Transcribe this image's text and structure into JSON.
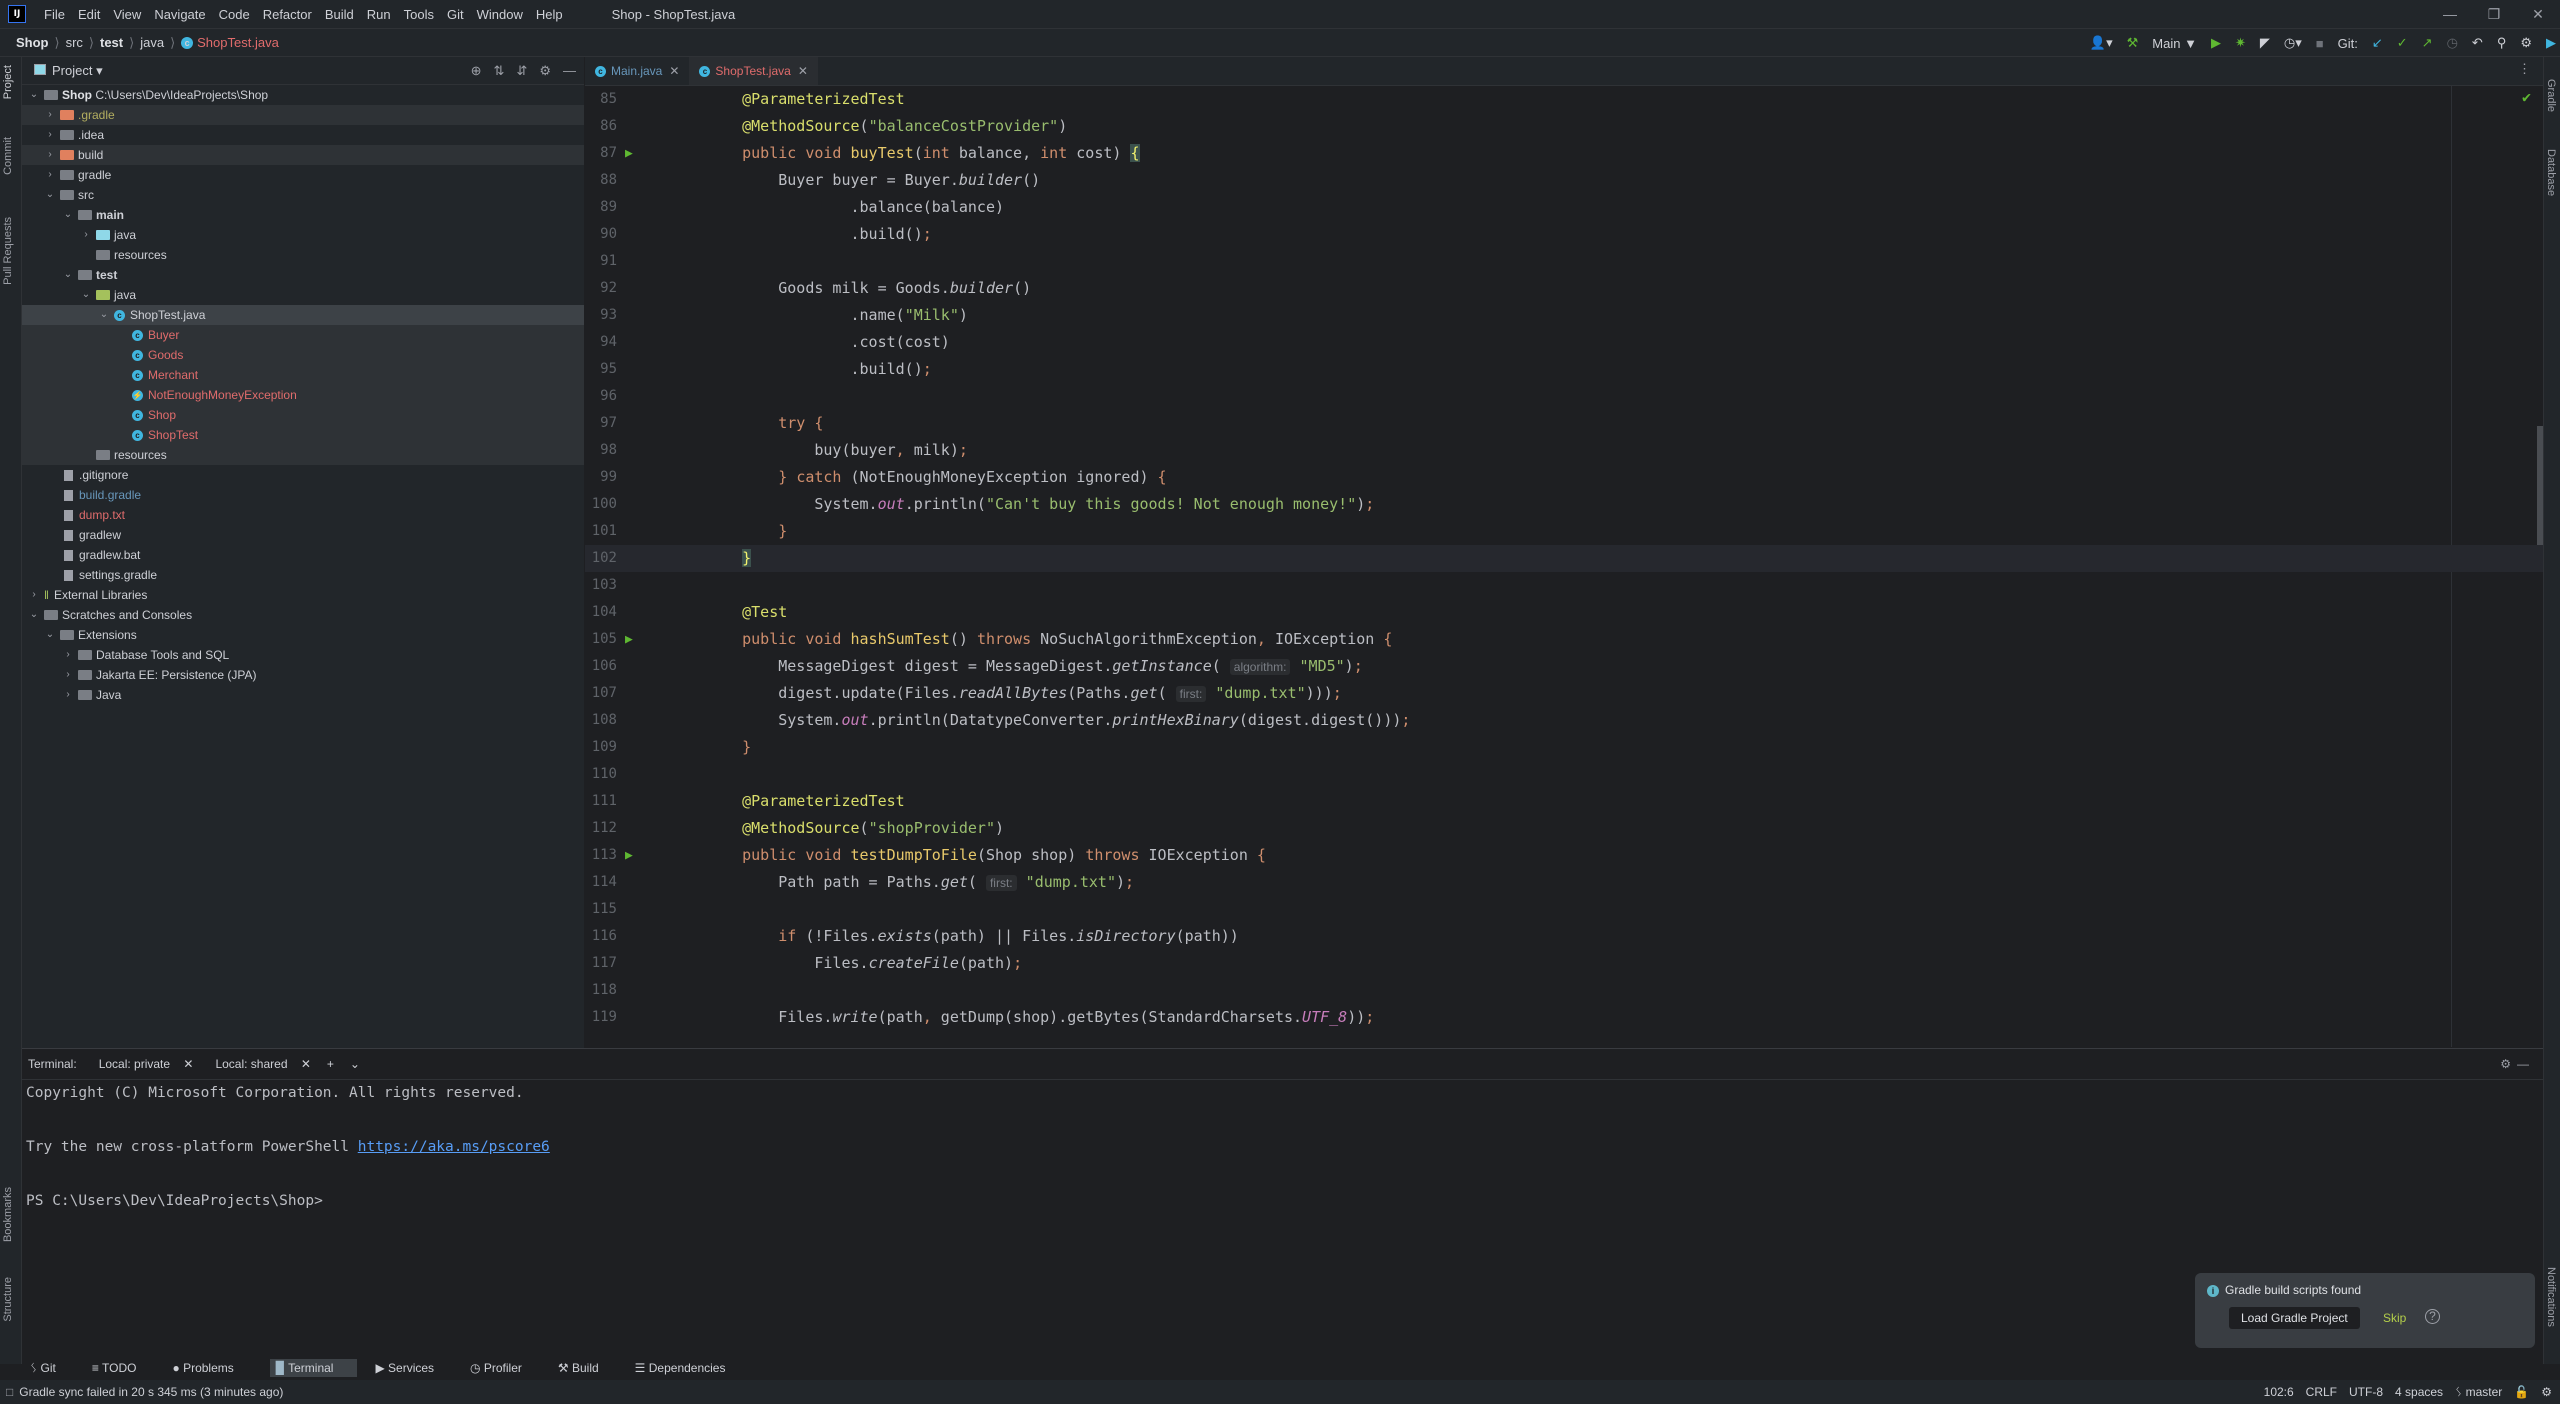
{
  "titlebar": {
    "logo": "IJ",
    "menus": [
      "File",
      "Edit",
      "View",
      "Navigate",
      "Code",
      "Refactor",
      "Build",
      "Run",
      "Tools",
      "Git",
      "Window",
      "Help"
    ],
    "window_title": "Shop - ShopTest.java"
  },
  "breadcrumb": [
    "Shop",
    "src",
    "test",
    "java",
    "ShopTest.java"
  ],
  "toolbar": {
    "run_config": "Main",
    "git_label": "Git:"
  },
  "left_tabs": [
    "Project",
    "Commit",
    "Pull Requests",
    "Bookmarks",
    "Structure"
  ],
  "right_tabs": [
    "Gradle",
    "Database",
    "Notifications"
  ],
  "project": {
    "title": "Project",
    "root": {
      "name": "Shop",
      "path": "C:\\Users\\Dev\\IdeaProjects\\Shop"
    },
    "items": [
      {
        "label": ".gradle",
        "level": 1
      },
      {
        "label": ".idea",
        "level": 1
      },
      {
        "label": "build",
        "level": 1
      },
      {
        "label": "gradle",
        "level": 1
      },
      {
        "label": "src",
        "level": 1
      },
      {
        "label": "main",
        "level": 2
      },
      {
        "label": "java",
        "level": 3
      },
      {
        "label": "resources",
        "level": 3
      },
      {
        "label": "test",
        "level": 2
      },
      {
        "label": "java",
        "level": 3
      },
      {
        "label": "ShopTest.java",
        "level": 4
      },
      {
        "label": "Buyer",
        "level": 5
      },
      {
        "label": "Goods",
        "level": 5
      },
      {
        "label": "Merchant",
        "level": 5
      },
      {
        "label": "NotEnoughMoneyException",
        "level": 5
      },
      {
        "label": "Shop",
        "level": 5
      },
      {
        "label": "ShopTest",
        "level": 5
      },
      {
        "label": "resources",
        "level": 3
      },
      {
        "label": ".gitignore",
        "level": 1
      },
      {
        "label": "build.gradle",
        "level": 1
      },
      {
        "label": "dump.txt",
        "level": 1
      },
      {
        "label": "gradlew",
        "level": 1
      },
      {
        "label": "gradlew.bat",
        "level": 1
      },
      {
        "label": "settings.gradle",
        "level": 1
      },
      {
        "label": "External Libraries",
        "level": 0
      },
      {
        "label": "Scratches and Consoles",
        "level": 0
      },
      {
        "label": "Extensions",
        "level": 1
      },
      {
        "label": "Database Tools and SQL",
        "level": 2
      },
      {
        "label": "Jakarta EE: Persistence (JPA)",
        "level": 2
      },
      {
        "label": "Java",
        "level": 2
      }
    ]
  },
  "editor": {
    "tabs": [
      "Main.java",
      "ShopTest.java"
    ],
    "active_tab": "ShopTest.java",
    "line_numbers": [
      "85",
      "86",
      "87",
      "88",
      "89",
      "90",
      "91",
      "92",
      "93",
      "94",
      "95",
      "96",
      "97",
      "98",
      "99",
      "100",
      "101",
      "102",
      "103",
      "104",
      "105",
      "106",
      "107",
      "108",
      "109",
      "110",
      "111",
      "112",
      "113",
      "114",
      "115",
      "116",
      "117",
      "118",
      "119"
    ],
    "hints": {
      "algorithm": "algorithm:",
      "first": "first:"
    },
    "strings": {
      "balanceCostProvider": "\"balanceCostProvider\"",
      "milk": "\"Milk\"",
      "cant_buy": "\"Can't buy this goods! Not enough money!\"",
      "md5": "\"MD5\"",
      "dump": "\"dump.txt\"",
      "shopProvider": "\"shopProvider\""
    }
  },
  "terminal": {
    "label": "Terminal:",
    "tabs": [
      "Local: private",
      "Local: shared"
    ],
    "lines": [
      "Copyright (C) Microsoft Corporation. All rights reserved.",
      "",
      "Try the new cross-platform PowerShell ",
      "",
      "PS C:\\Users\\Dev\\IdeaProjects\\Shop>"
    ],
    "link": "https://aka.ms/pscore6"
  },
  "notification": {
    "title": "Gradle build scripts found",
    "load_button": "Load Gradle Project",
    "skip": "Skip"
  },
  "tool_windows": [
    "Git",
    "TODO",
    "Problems",
    "Terminal",
    "Services",
    "Profiler",
    "Build",
    "Dependencies"
  ],
  "status": {
    "message": "Gradle sync failed in 20 s 345 ms (3 minutes ago)",
    "position": "102:6",
    "line_ending": "CRLF",
    "encoding": "UTF-8",
    "indent": "4 spaces",
    "branch": "master"
  }
}
